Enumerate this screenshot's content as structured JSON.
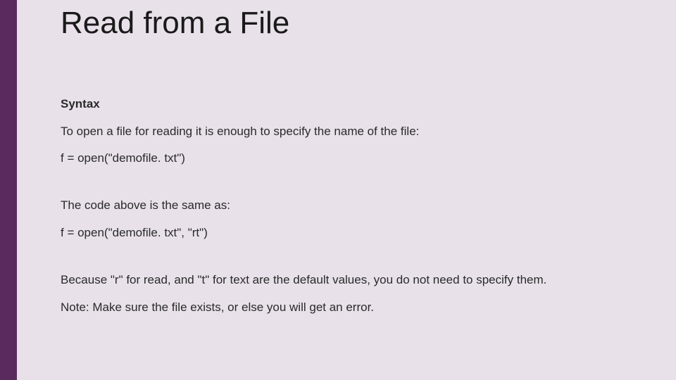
{
  "slide": {
    "title": "Read from a File",
    "subheading": "Syntax",
    "line1": "To open a file for reading it is enough to specify the name of the file:",
    "code1": "f = open(\"demofile. txt\")",
    "line2": "The code above is the same as:",
    "code2": "f = open(\"demofile. txt\", \"rt\")",
    "line3": "Because \"r\" for read, and \"t\" for text are the default values, you do not need to specify them.",
    "line4": "Note: Make sure the file exists, or else you will get an error."
  }
}
